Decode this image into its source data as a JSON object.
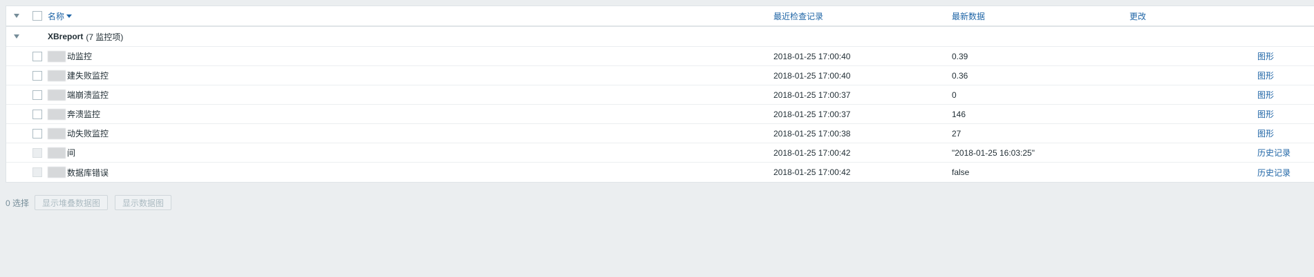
{
  "header": {
    "name_label": "名称",
    "last_check_label": "最近检查记录",
    "latest_data_label": "最新数据",
    "change_label": "更改"
  },
  "group": {
    "name": "XBreport",
    "count_label": "(7 监控项)"
  },
  "rows": [
    {
      "name": "动监控",
      "last_check": "2018-01-25 17:00:40",
      "data": "0.39",
      "action": "图形",
      "checkbox_enabled": true
    },
    {
      "name": "建失败监控",
      "last_check": "2018-01-25 17:00:40",
      "data": "0.36",
      "action": "图形",
      "checkbox_enabled": true
    },
    {
      "name": "端崩溃监控",
      "last_check": "2018-01-25 17:00:37",
      "data": "0",
      "action": "图形",
      "checkbox_enabled": true
    },
    {
      "name": "奔溃监控",
      "last_check": "2018-01-25 17:00:37",
      "data": "146",
      "action": "图形",
      "checkbox_enabled": true
    },
    {
      "name": "动失败监控",
      "last_check": "2018-01-25 17:00:38",
      "data": "27",
      "action": "图形",
      "checkbox_enabled": true
    },
    {
      "name": "间",
      "last_check": "2018-01-25 17:00:42",
      "data": "\"2018-01-25 16:03:25\"",
      "action": "历史记录",
      "checkbox_enabled": false
    },
    {
      "name": "数据库错误",
      "last_check": "2018-01-25 17:00:42",
      "data": "false",
      "action": "历史记录",
      "checkbox_enabled": false
    }
  ],
  "footer": {
    "selected_count": "0 选择",
    "btn_stacked_graph": "显示堆叠数据图",
    "btn_graph": "显示数据图"
  }
}
